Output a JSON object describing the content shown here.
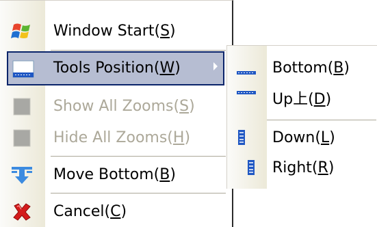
{
  "main_menu": {
    "items": [
      {
        "label": "Window Start(",
        "mnemonic": "S",
        "suffix": ")",
        "icon": "windows-logo-icon",
        "enabled": true
      },
      {
        "label": "Tools Position(",
        "mnemonic": "W",
        "suffix": ")",
        "icon": "toolbar-position-icon",
        "enabled": true,
        "highlighted": true,
        "has_submenu": true
      },
      {
        "label": "Show All Zooms(",
        "mnemonic": "S",
        "suffix": ")",
        "icon": "gray-square-icon",
        "enabled": false
      },
      {
        "label": "Hide All Zooms(",
        "mnemonic": "H",
        "suffix": ")",
        "icon": "gray-square-icon",
        "enabled": false
      },
      {
        "label": "Move Bottom(",
        "mnemonic": "B",
        "suffix": ")",
        "icon": "move-down-icon",
        "enabled": true
      },
      {
        "label": "Cancel(",
        "mnemonic": "C",
        "suffix": ")",
        "icon": "red-x-icon",
        "enabled": true
      }
    ]
  },
  "submenu": {
    "items": [
      {
        "label": "Bottom(",
        "mnemonic": "B",
        "suffix": ")",
        "icon": "bar-bottom-icon"
      },
      {
        "label": "Up上(",
        "mnemonic": "D",
        "suffix": ")",
        "icon": "bar-top-icon"
      },
      {
        "label": "Down(",
        "mnemonic": "L",
        "suffix": ")",
        "icon": "bar-left-icon"
      },
      {
        "label": "Right(",
        "mnemonic": "R",
        "suffix": ")",
        "icon": "bar-right-icon"
      }
    ]
  },
  "colors": {
    "highlight_fill": "#b6bdd2",
    "highlight_border": "#0a246a",
    "disabled_text": "#aca899",
    "icon_blue": "#1f57c3",
    "cancel_red": "#d41c1c"
  }
}
